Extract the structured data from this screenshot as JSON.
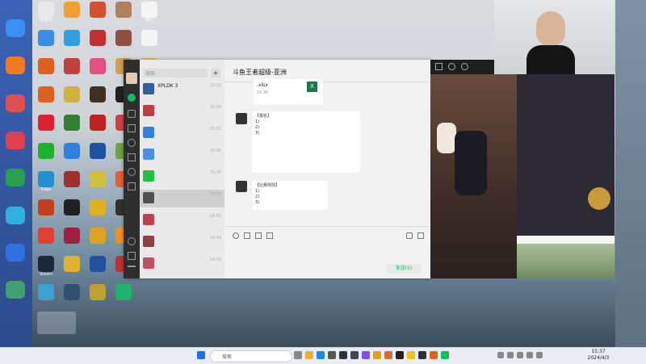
{
  "desktop_icons": [
    {
      "label": "回收站",
      "color": "#e8e8e8"
    },
    {
      "label": "",
      "color": "#f0a030"
    },
    {
      "label": "",
      "color": "#d05030"
    },
    {
      "label": "",
      "color": "#b08060"
    },
    {
      "label": "图片",
      "color": "#f4f4f4"
    },
    {
      "label": "",
      "color": "#3a8ee8"
    },
    {
      "label": "",
      "color": "#30a0e0"
    },
    {
      "label": "",
      "color": "#c03030"
    },
    {
      "label": "",
      "color": "#905040"
    },
    {
      "label": "",
      "color": "#f4f4f4"
    },
    {
      "label": "",
      "color": "#e06020"
    },
    {
      "label": "",
      "color": "#c04040"
    },
    {
      "label": "",
      "color": "#e05080"
    },
    {
      "label": "",
      "color": "#d0a050"
    },
    {
      "label": "",
      "color": "#f0c040"
    },
    {
      "label": "",
      "color": "#e06020"
    },
    {
      "label": "",
      "color": "#d0b040"
    },
    {
      "label": "",
      "color": "#403020"
    },
    {
      "label": "",
      "color": "#202020"
    },
    {
      "label": "",
      "color": "#f0d020"
    },
    {
      "label": "",
      "color": "#e02030"
    },
    {
      "label": "",
      "color": "#308030"
    },
    {
      "label": "",
      "color": "#c02020"
    },
    {
      "label": "",
      "color": "#d04040"
    },
    {
      "label": "",
      "color": "#3060c0"
    },
    {
      "label": "",
      "color": "#20b030"
    },
    {
      "label": "",
      "color": "#3080e0"
    },
    {
      "label": "",
      "color": "#2050a0"
    },
    {
      "label": "",
      "color": "#70a040"
    },
    {
      "label": "",
      "color": "#3070e0"
    },
    {
      "label": "Edge",
      "color": "#2090d0"
    },
    {
      "label": "",
      "color": "#a03030"
    },
    {
      "label": "",
      "color": "#d0c040"
    },
    {
      "label": "",
      "color": "#e06030"
    },
    {
      "label": "",
      "color": "#a06080"
    },
    {
      "label": "",
      "color": "#c04020"
    },
    {
      "label": "",
      "color": "#202020"
    },
    {
      "label": "",
      "color": "#e0b020"
    },
    {
      "label": "",
      "color": "#303030"
    },
    {
      "label": "",
      "color": "#c03030"
    },
    {
      "label": "",
      "color": "#e04030"
    },
    {
      "label": "",
      "color": "#a02040"
    },
    {
      "label": "",
      "color": "#e0a020"
    },
    {
      "label": "",
      "color": "#f09020"
    },
    {
      "label": "",
      "color": "#504040"
    },
    {
      "label": "Steam",
      "color": "#1b2838"
    },
    {
      "label": "",
      "color": "#e0b030"
    },
    {
      "label": "",
      "color": "#2050a0"
    },
    {
      "label": "",
      "color": "#c03030"
    },
    {
      "label": "",
      "color": "#20a0c0"
    },
    {
      "label": "",
      "color": "#40a0d0"
    },
    {
      "label": "",
      "color": "#305070"
    },
    {
      "label": "",
      "color": "#c0a030"
    },
    {
      "label": "",
      "color": "#20b070"
    }
  ],
  "wechat": {
    "search_placeholder": "搜索",
    "add_button": "+",
    "chats": [
      {
        "name": "XPLDK 3",
        "preview": "",
        "time": "15:30",
        "color": "#3060a0"
      },
      {
        "name": "",
        "preview": "",
        "time": "15:29",
        "color": "#c04040"
      },
      {
        "name": "",
        "preview": "",
        "time": "15:22",
        "color": "#3080e0"
      },
      {
        "name": "",
        "preview": "",
        "time": "15:20",
        "color": "#4a90e2"
      },
      {
        "name": "",
        "preview": "",
        "time": "15:16",
        "color": "#20c040"
      },
      {
        "name": "",
        "preview": "",
        "time": "15:02",
        "color": "#505050"
      },
      {
        "name": "",
        "preview": "",
        "time": "14:55",
        "color": "#c04050"
      },
      {
        "name": "",
        "preview": "",
        "time": "14:49",
        "color": "#904040"
      },
      {
        "name": "",
        "preview": "",
        "time": "14:30",
        "color": "#c05060"
      }
    ],
    "chat_title": "斗鱼王者超级-亚洲",
    "file_name": ".xlsx",
    "file_size": "16.3K",
    "messages": [
      "【报名】\n1) \n2) \n3) ",
      "【比赛规则】\n1) \n2) \n3) "
    ],
    "footer_note": "",
    "send_button": "发送(S)"
  },
  "stream": {
    "danmu": [
      "",
      "",
      "",
      "",
      ""
    ],
    "footer": ""
  },
  "taskbar": {
    "search_placeholder": "搜索",
    "time": "15:37",
    "date": "2024/4/3"
  }
}
